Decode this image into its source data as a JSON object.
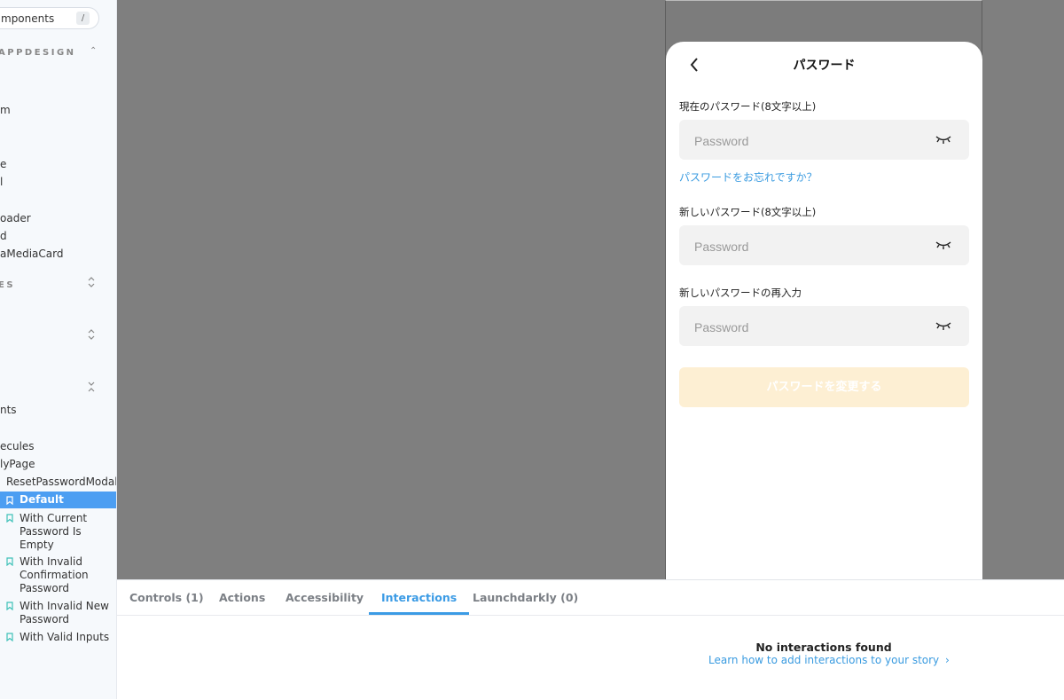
{
  "sidebar": {
    "search_text": "mponents",
    "search_shortcut": "/",
    "group_1": "APPDESIGN",
    "group_2": "ES",
    "items": [
      "m",
      "e",
      "l",
      "oader",
      "d",
      "aMediaCard",
      "nts",
      "ecules",
      "lyPage",
      "ResetPasswordModal"
    ],
    "stories": [
      {
        "label": "Default",
        "active": true
      },
      {
        "label": "With Current Password Is Empty"
      },
      {
        "label": "With Invalid Confirmation Password"
      },
      {
        "label": "With Invalid New Password"
      },
      {
        "label": "With Valid Inputs"
      }
    ]
  },
  "modal": {
    "title": "パスワード",
    "current_label": "現在のパスワード(8文字以上)",
    "new_label": "新しいパスワード(8文字以上)",
    "confirm_label": "新しいパスワードの再入力",
    "placeholder": "Password",
    "forgot_link": "パスワードをお忘れですか？",
    "submit_label": "パスワードを変更する"
  },
  "addons": {
    "tabs": [
      "Controls (1)",
      "Actions",
      "Accessibility",
      "Interactions",
      "Launchdarkly (0)"
    ],
    "active_tab": "Interactions",
    "empty_title": "No interactions found",
    "empty_link": "Learn how to add interactions to your story"
  },
  "colors": {
    "accent": "#4c9ef2",
    "link": "#3a9be0",
    "canvas_bg": "#7f7f7f",
    "submit_disabled": "#fdefd3"
  }
}
